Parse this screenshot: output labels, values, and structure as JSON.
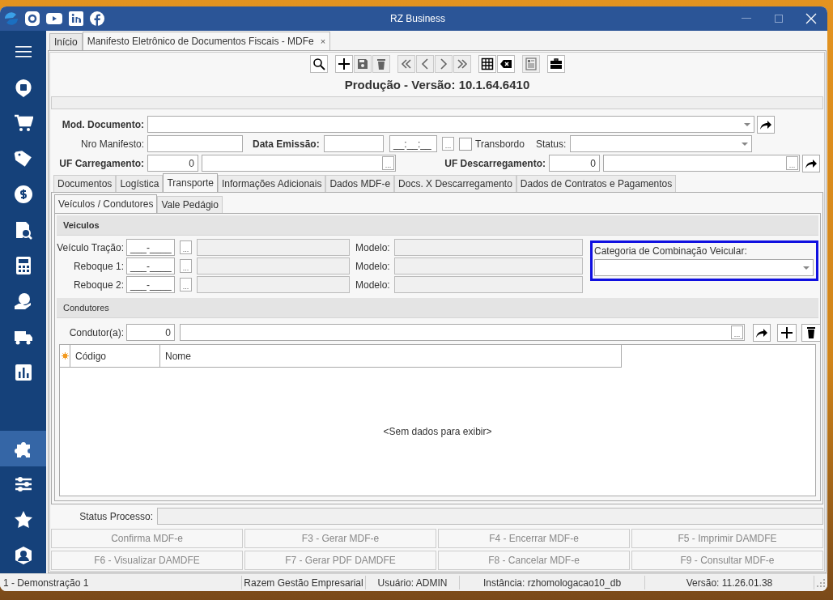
{
  "window": {
    "title": "RZ Business"
  },
  "social": [
    {
      "kind": "logo"
    },
    {
      "kind": "instagram"
    },
    {
      "kind": "youtube"
    },
    {
      "kind": "linkedin"
    },
    {
      "kind": "facebook"
    }
  ],
  "sidebar": {
    "items": [
      {
        "kind": "menu",
        "selected": false
      },
      {
        "kind": "chat",
        "selected": false
      },
      {
        "kind": "cart",
        "selected": false
      },
      {
        "kind": "tag",
        "selected": false
      },
      {
        "kind": "dollar",
        "selected": false
      },
      {
        "kind": "report",
        "selected": false
      },
      {
        "kind": "calculator",
        "selected": false
      },
      {
        "kind": "hand",
        "selected": false
      },
      {
        "kind": "truck",
        "selected": false
      },
      {
        "kind": "chart",
        "selected": false
      }
    ],
    "bottom_items": [
      {
        "kind": "puzzle",
        "selected": true
      },
      {
        "kind": "sliders",
        "selected": false
      },
      {
        "kind": "star",
        "selected": false
      },
      {
        "kind": "user",
        "selected": false
      }
    ]
  },
  "doc_tabs": [
    {
      "label": "Início",
      "selected": false
    },
    {
      "label": "Manifesto Eletrônico de Documentos Fiscais - MDFe",
      "selected": true,
      "close": "×"
    }
  ],
  "toolbar": [
    {
      "kind": "search",
      "disabled": false
    },
    {
      "kind": "gap"
    },
    {
      "kind": "plus",
      "disabled": false
    },
    {
      "kind": "save",
      "disabled": true
    },
    {
      "kind": "trash",
      "disabled": true
    },
    {
      "kind": "gap"
    },
    {
      "kind": "first",
      "disabled": true
    },
    {
      "kind": "prev",
      "disabled": true
    },
    {
      "kind": "next",
      "disabled": true
    },
    {
      "kind": "last",
      "disabled": true
    },
    {
      "kind": "gap"
    },
    {
      "kind": "grid",
      "disabled": false
    },
    {
      "kind": "erase",
      "disabled": false
    },
    {
      "kind": "gap"
    },
    {
      "kind": "form",
      "disabled": true
    },
    {
      "kind": "gap"
    },
    {
      "kind": "briefcase",
      "disabled": false
    }
  ],
  "heading": "Produção - Versão: 10.1.64.6410",
  "form": {
    "mod_documento": {
      "label": "Mod. Documento:"
    },
    "nro_manifesto": {
      "label": "Nro Manifesto:"
    },
    "data_emissao": {
      "label": "Data Emissão:",
      "time": "__:__:__",
      "button": "..."
    },
    "transbordo": {
      "label": "Transbordo",
      "checked": false
    },
    "status": {
      "label": "Status:"
    },
    "uf_carregamento": {
      "label": "UF Carregamento:",
      "value": "0",
      "button": "..."
    },
    "uf_descarregamento": {
      "label": "UF Descarregamento:",
      "value": "0",
      "button": "..."
    }
  },
  "tabs": [
    {
      "label": "Documentos",
      "selected": false
    },
    {
      "label": "Logística",
      "selected": false
    },
    {
      "label": "Transporte",
      "selected": true
    },
    {
      "label": "Informações Adicionais",
      "selected": false
    },
    {
      "label": "Dados MDF-e",
      "selected": false
    },
    {
      "label": "Docs. X Descarregamento",
      "selected": false
    },
    {
      "label": "Dados de Contratos e Pagamentos",
      "selected": false
    }
  ],
  "subtabs": [
    {
      "label": "Veículos / Condutores",
      "selected": true
    },
    {
      "label": "Vale Pedágio",
      "selected": false
    }
  ],
  "veiculos": {
    "title": "Veiculos",
    "rows": [
      {
        "label": "Veículo Tração:",
        "plate": "___-____",
        "button": "...",
        "model_label": "Modelo:"
      },
      {
        "label": "Reboque 1:",
        "plate": "___-____",
        "button": "...",
        "model_label": "Modelo:"
      },
      {
        "label": "Reboque 2:",
        "plate": "___-____",
        "button": "...",
        "model_label": "Modelo:"
      }
    ],
    "categoria": {
      "label": "Categoria de Combinação Veicular:",
      "focused": true
    }
  },
  "condutores": {
    "title": "Condutores",
    "label": "Condutor(a):",
    "value": "0",
    "button": "...",
    "table": {
      "columns": [
        "Código",
        "Nome"
      ],
      "empty": "<Sem dados para exibir>"
    }
  },
  "status_processo": {
    "label": "Status Processo:"
  },
  "actions": [
    {
      "label": "Confirma MDF-e",
      "disabled": true
    },
    {
      "label": "F3 - Gerar MDF-e",
      "disabled": true
    },
    {
      "label": "F4 - Encerrar MDF-e",
      "disabled": true
    },
    {
      "label": "F5 - Imprimir DAMDFE",
      "disabled": true
    },
    {
      "label": "F6 - Visualizar DAMDFE",
      "disabled": true
    },
    {
      "label": "F7 - Gerar PDF DAMDFE",
      "disabled": true
    },
    {
      "label": "F8 - Cancelar MDF-e",
      "disabled": true
    },
    {
      "label": "F9 - Consultar MDF-e",
      "disabled": true
    }
  ],
  "status_bar": [
    "1 - Demonstração 1",
    "Razem Gestão Empresarial",
    "Usuário: ADMIN",
    "Instância: rzhomologacao10_db",
    "Versão: 11.26.01.38"
  ]
}
